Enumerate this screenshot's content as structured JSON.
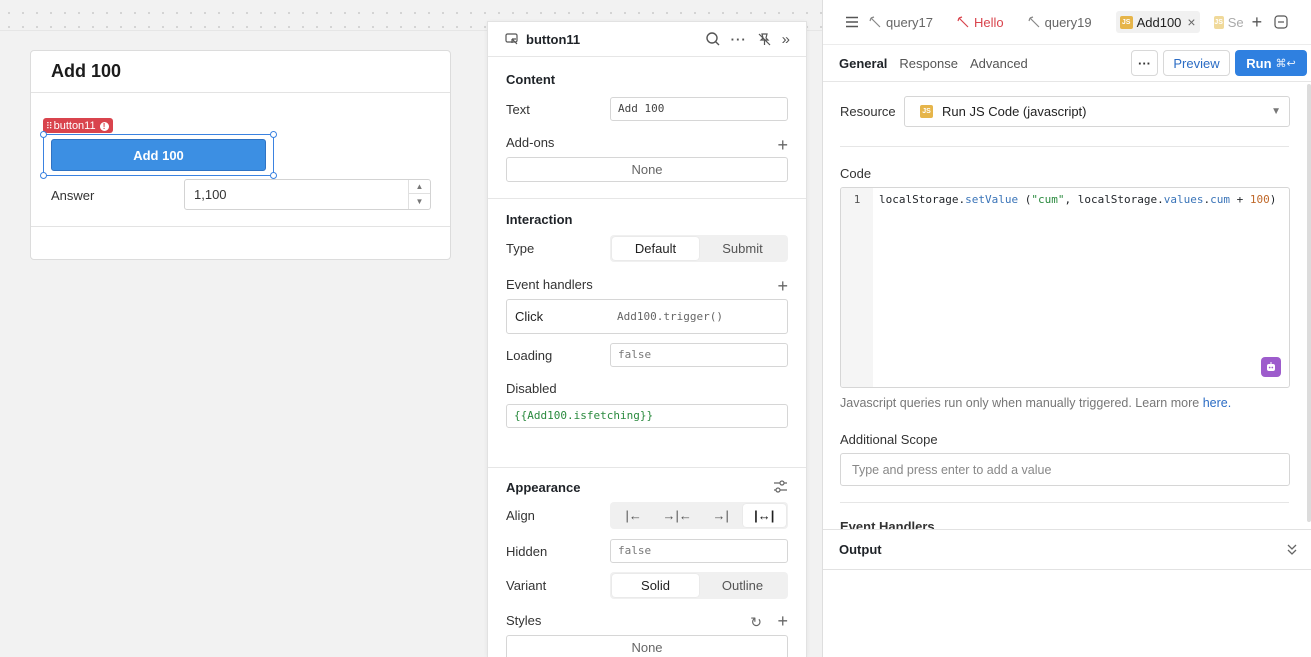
{
  "canvas": {
    "container": {
      "title": "Add 100"
    },
    "selection_badge": "button11",
    "button": {
      "label": "Add 100"
    },
    "answer": {
      "label": "Answer",
      "value": "1,100"
    }
  },
  "inspector": {
    "title": "button11",
    "content": {
      "heading": "Content",
      "text_label": "Text",
      "text_value": "Add 100",
      "addons_label": "Add-ons",
      "addons_value": "None"
    },
    "interaction": {
      "heading": "Interaction",
      "type_label": "Type",
      "type_options": [
        "Default",
        "Submit"
      ],
      "type_selected": "Default",
      "events_label": "Event handlers",
      "event_name": "Click",
      "event_action": "Add100.trigger()",
      "loading_label": "Loading",
      "loading_value": "false",
      "disabled_label": "Disabled",
      "disabled_value": "{{Add100.isfetching}}"
    },
    "appearance": {
      "heading": "Appearance",
      "align_label": "Align",
      "hidden_label": "Hidden",
      "hidden_value": "false",
      "variant_label": "Variant",
      "variant_options": [
        "Solid",
        "Outline"
      ],
      "variant_selected": "Solid",
      "styles_label": "Styles",
      "styles_value": "None"
    }
  },
  "query": {
    "tabs": [
      {
        "label": "query17"
      },
      {
        "label": "Hello"
      },
      {
        "label": "query19"
      },
      {
        "label": "Add100",
        "active": true
      },
      {
        "label": "Se"
      }
    ],
    "subtabs": [
      "General",
      "Response",
      "Advanced"
    ],
    "preview_label": "Preview",
    "run_label": "Run",
    "run_shortcut": "⌘↩",
    "resource_label": "Resource",
    "resource_value": "Run JS Code (javascript)",
    "code_label": "Code",
    "code_line_number": "1",
    "code": {
      "p1": "localStorage.",
      "p2": "setValue",
      "p3": " (",
      "p4": "\"cum\"",
      "p5": ", localStorage.",
      "p6": "values",
      "p7": ".",
      "p8": "cum",
      "p9": " + ",
      "p10": "100",
      "p11": ")"
    },
    "helper_text": "Javascript queries run only when manually triggered. Learn more ",
    "helper_link": "here.",
    "scope_label": "Additional Scope",
    "scope_placeholder": "Type and press enter to add a value",
    "event_handlers_label": "Event Handlers",
    "output_label": "Output"
  },
  "colors": {
    "accent": "#2f80e0",
    "button_fill": "#3c8fe3",
    "selection_badge": "#d9444d",
    "hello_tab": "#d9444d",
    "js_badge": "#e6b54a"
  }
}
